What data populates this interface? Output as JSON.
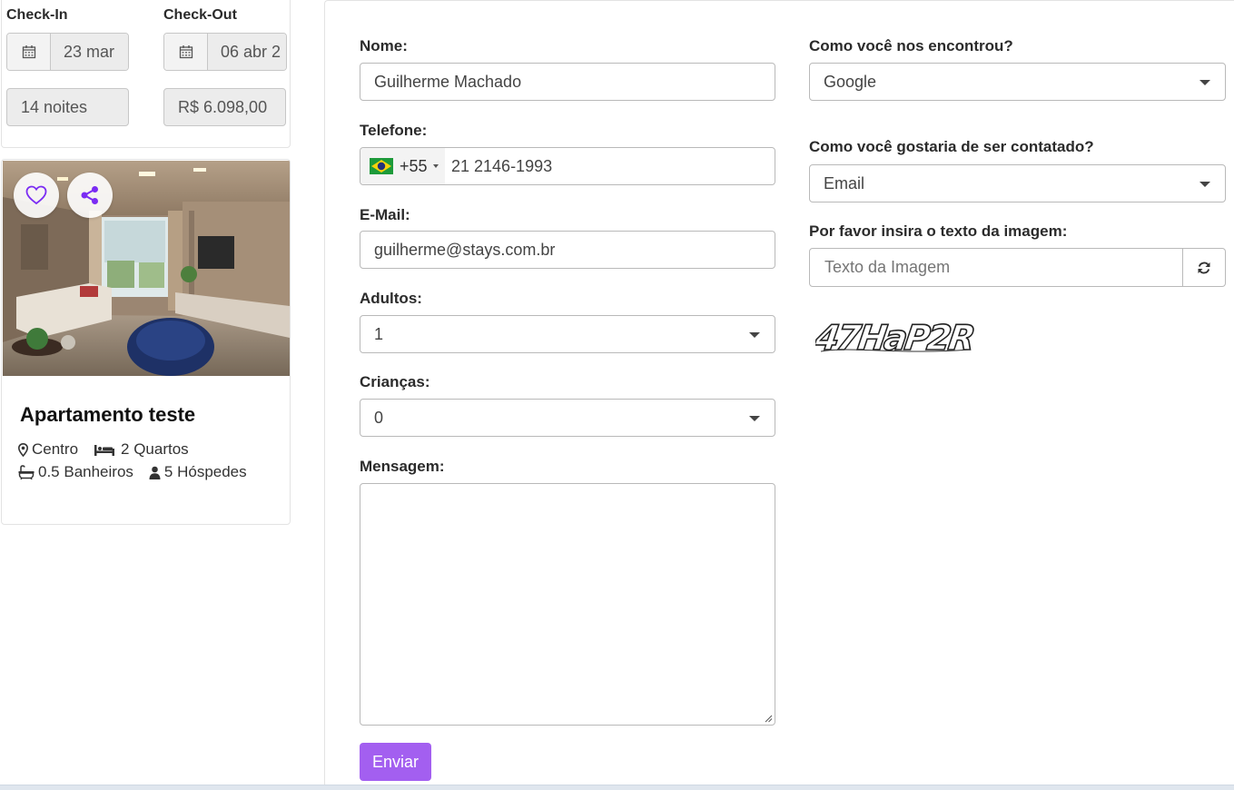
{
  "booking": {
    "checkin_label": "Check-In",
    "checkout_label": "Check-Out",
    "checkin_value": "23 mar",
    "checkout_value": "06 abr 2",
    "nights": "14 noites",
    "total": "R$ 6.098,00"
  },
  "property": {
    "title": "Apartamento teste",
    "location": "Centro",
    "rooms": "2 Quartos",
    "baths": "0.5 Banheiros",
    "guests": "5 Hóspedes",
    "accent_color": "#7b2cf3"
  },
  "form": {
    "name_label": "Nome:",
    "name_value": "Guilherme Machado",
    "phone_label": "Telefone:",
    "phone_code": "+55",
    "phone_value": "21 2146-1993",
    "email_label": "E-Mail:",
    "email_value": "guilherme@stays.com.br",
    "adults_label": "Adultos:",
    "adults_value": "1",
    "children_label": "Crianças:",
    "children_value": "0",
    "message_label": "Mensagem:",
    "source_label": "Como você nos encontrou?",
    "source_value": "Google",
    "contact_label": "Como você gostaria de ser contatado?",
    "contact_value": "Email",
    "captcha_label": "Por favor insira o texto da imagem:",
    "captcha_placeholder": "Texto da Imagem",
    "captcha_text": "47HaP2R",
    "submit_label": "Enviar",
    "submit_color": "#a35ff0"
  }
}
